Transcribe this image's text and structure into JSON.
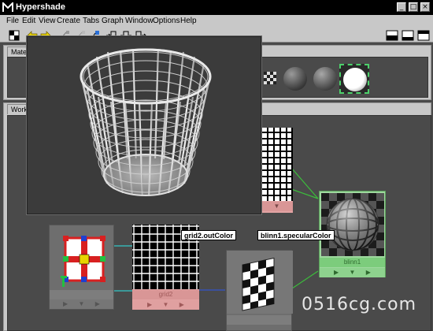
{
  "window": {
    "title": "Hypershade",
    "buttons": [
      "_",
      "□",
      "×"
    ]
  },
  "menu": [
    "File",
    "Edit",
    "View",
    "Create",
    "Tabs",
    "Graph",
    "Window",
    "Options",
    "Help"
  ],
  "tabs": {
    "materials": "Mate",
    "work_area": "Work"
  },
  "nodes": {
    "grid2": {
      "label": "grid2"
    },
    "blinn1": {
      "label": "blinn1"
    }
  },
  "tooltips": {
    "grid_out": "grid2.outColor",
    "blinn_spec": "blinn1.specularColor"
  },
  "watermark": "0516cg.com",
  "colors": {
    "node_pink": "#e3a3a3",
    "node_green": "#9ed89e",
    "connection_cyan": "#33c6c6",
    "connection_green": "#3bbf3b",
    "connection_blue": "#3355cc"
  }
}
